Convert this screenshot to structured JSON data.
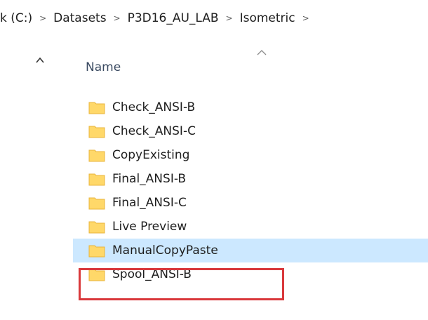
{
  "breadcrumb": {
    "items": [
      "k (C:)",
      "Datasets",
      "P3D16_AU_LAB",
      "Isometric"
    ],
    "separator": ">"
  },
  "header": {
    "name_label": "Name",
    "sort_indicator": "ascending"
  },
  "folders": [
    {
      "name": "Check_ANSI-B",
      "selected": false
    },
    {
      "name": "Check_ANSI-C",
      "selected": false
    },
    {
      "name": "CopyExisting",
      "selected": false
    },
    {
      "name": "Final_ANSI-B",
      "selected": false
    },
    {
      "name": "Final_ANSI-C",
      "selected": false
    },
    {
      "name": "Live Preview",
      "selected": false
    },
    {
      "name": "ManualCopyPaste",
      "selected": true
    },
    {
      "name": "Spool_ANSI-B",
      "selected": false
    }
  ],
  "colors": {
    "selection_background": "#cce8ff",
    "highlight_border": "#d9383b",
    "folder_fill": "#ffd869",
    "folder_edge": "#e8b53c"
  },
  "icons": {
    "folder": "folder-icon",
    "nav_collapse": "chevron-up-icon",
    "sort": "sort-ascending-icon",
    "separator": "chevron-right-icon"
  }
}
